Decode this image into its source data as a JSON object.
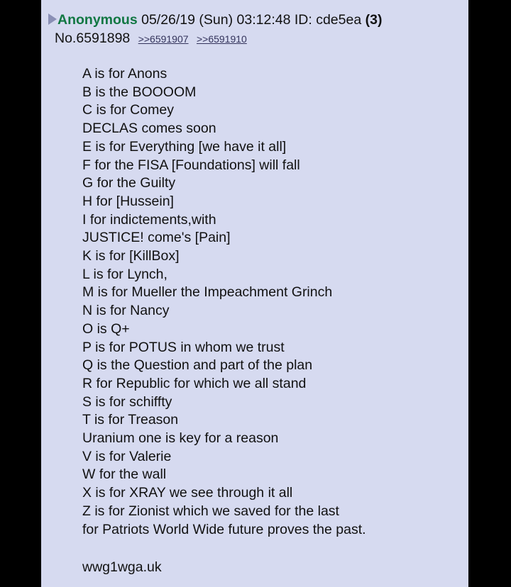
{
  "post": {
    "name": "Anonymous",
    "datetime": "05/26/19 (Sun) 03:12:48",
    "id_label": "ID:",
    "id_value": "cde5ea",
    "reply_count": "(3)",
    "number": "No.6591898",
    "backlinks": [
      ">>6591907",
      ">>6591910"
    ],
    "lines": [
      "A is for Anons",
      "B is the BOOOOM",
      "C is for Comey",
      "DECLAS comes soon",
      "E is for Everything [we have it all]",
      "F for the FISA [Foundations] will fall",
      "G for the Guilty",
      "H for [Hussein]",
      "I for indictements,with",
      "JUSTICE! come's [Pain]",
      "K is for [KillBox]",
      "L is for Lynch,",
      "M is for Mueller the Impeachment Grinch",
      "N is for Nancy",
      "O is Q+",
      "P is for POTUS in whom we trust",
      "Q is the Question and part of the plan",
      "R for Republic for which we all stand",
      "S is for schiffty",
      "T is for Treason",
      "Uranium one is key for a reason",
      "V is for Valerie",
      "W for the wall",
      "X is for XRAY we see through it all",
      "Z is for Zionist which we saved for the last",
      "for Patriots World Wide future proves the past."
    ],
    "footer_text": "wwg1wga.uk"
  },
  "colors": {
    "post_background": "#d6daf0",
    "name": "#117743",
    "backlink": "#34345c",
    "page_background": "#000000"
  },
  "icons": {
    "hide_toggle": "hide-post-icon"
  }
}
